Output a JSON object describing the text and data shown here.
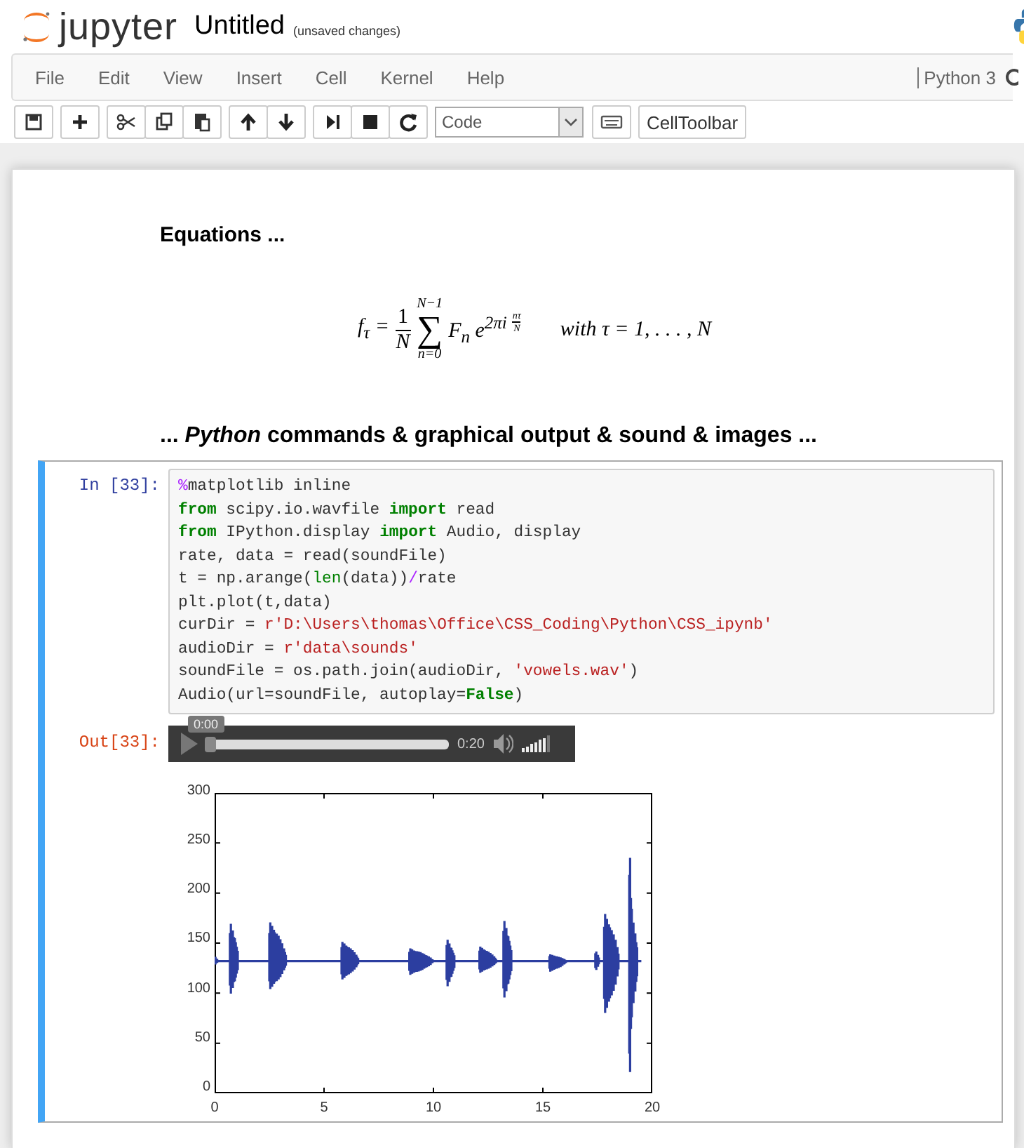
{
  "header": {
    "logo": "jupyter",
    "title": "Untitled",
    "save_status": "(unsaved changes)"
  },
  "menu": [
    "File",
    "Edit",
    "View",
    "Insert",
    "Cell",
    "Kernel",
    "Help"
  ],
  "kernel": "Python 3",
  "toolbar": {
    "cell_type": "Code",
    "cell_toolbar": "CellToolbar"
  },
  "markdown": {
    "heading": "Equations ...",
    "equation": {
      "lhs": "f$_{τ}$ =",
      "numerator": "1",
      "denominator": "N",
      "sum_upper": "N−1",
      "sum_symbol": "∑",
      "sum_lower": "n=0",
      "term": "F$_{n}$ e$^{2πi}$",
      "exp_numerator": "nτ",
      "exp_denominator": "N",
      "condition": "with τ = 1, . . . , N"
    },
    "subheading": "... *Python* commands & graphical output & sound & images ..."
  },
  "code_cell": {
    "in_prompt": "In [33]:",
    "out_prompt": "Out[33]:",
    "selected": true,
    "lines": [
      [
        {
          "kind": "magic",
          "text": "%"
        },
        {
          "kind": "plain",
          "text": "matplotlib inline"
        }
      ],
      [
        {
          "kind": "keyword",
          "text": "from"
        },
        {
          "kind": "plain",
          "text": " scipy.io.wavfile "
        },
        {
          "kind": "keyword",
          "text": "import"
        },
        {
          "kind": "plain",
          "text": " read"
        }
      ],
      [
        {
          "kind": "keyword",
          "text": "from"
        },
        {
          "kind": "plain",
          "text": " IPython.display "
        },
        {
          "kind": "keyword",
          "text": "import"
        },
        {
          "kind": "plain",
          "text": " Audio, display"
        }
      ],
      [
        {
          "kind": "plain",
          "text": "rate, data = read(soundFile)"
        }
      ],
      [
        {
          "kind": "plain",
          "text": "t = np.arange("
        },
        {
          "kind": "builtin",
          "text": "len"
        },
        {
          "kind": "plain",
          "text": "(data))"
        },
        {
          "kind": "operator",
          "text": "/"
        },
        {
          "kind": "plain",
          "text": "rate"
        }
      ],
      [
        {
          "kind": "plain",
          "text": "plt.plot(t,data)"
        }
      ],
      [
        {
          "kind": "plain",
          "text": "curDir = "
        },
        {
          "kind": "string",
          "text": "r'D:\\Users\\thomas\\Office\\CSS_Coding\\Python\\CSS_ipynb'"
        }
      ],
      [
        {
          "kind": "plain",
          "text": "audioDir = "
        },
        {
          "kind": "string",
          "text": "r'data\\sounds'"
        }
      ],
      [
        {
          "kind": "plain",
          "text": "soundFile = os.path.join(audioDir, "
        },
        {
          "kind": "string",
          "text": "'vowels.wav'"
        },
        {
          "kind": "plain",
          "text": ")"
        }
      ],
      [
        {
          "kind": "plain",
          "text": "Audio(url=soundFile, autoplay="
        },
        {
          "kind": "keyword",
          "text": "False"
        },
        {
          "kind": "plain",
          "text": ")"
        }
      ]
    ],
    "audio": {
      "tooltip": "0:00",
      "duration": "0:20",
      "level": 0.0,
      "volume": {
        "level": 0.85
      }
    },
    "plot": {
      "yticks": [
        "300",
        "250",
        "200",
        "150",
        "100",
        "50",
        "0"
      ],
      "xticks": [
        "0",
        "5",
        "10",
        "15",
        "20"
      ]
    }
  }
}
